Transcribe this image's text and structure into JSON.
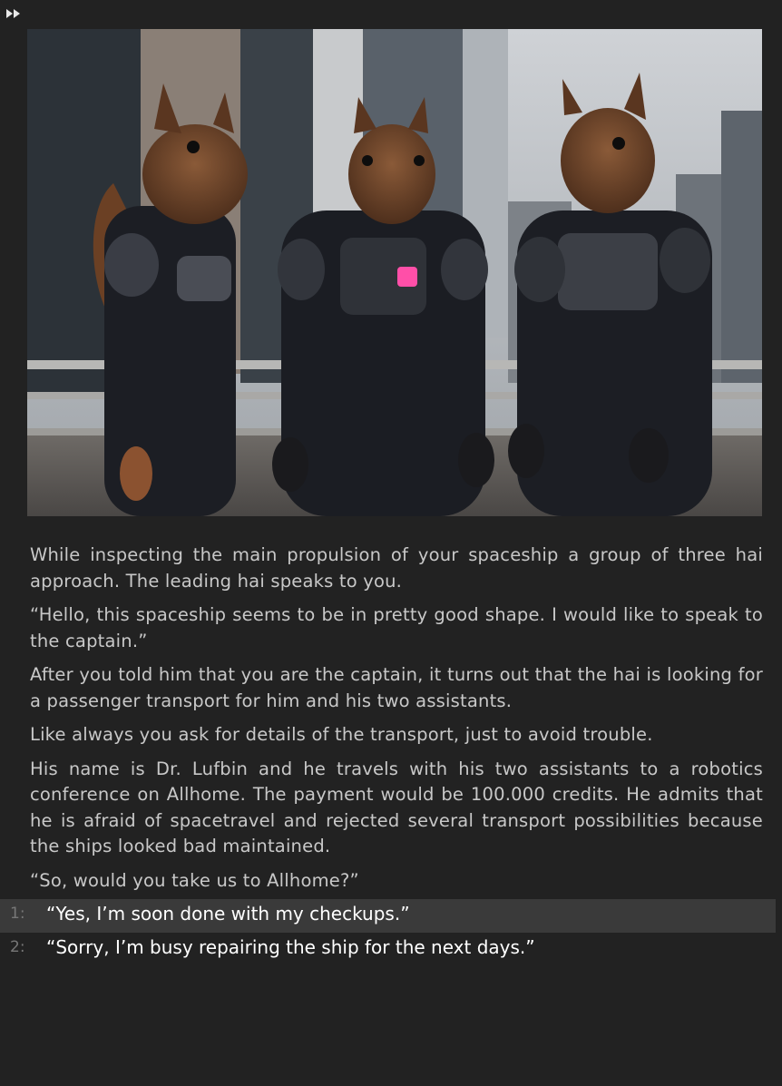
{
  "toolbar": {
    "skip_icon": "fast-forward-icon"
  },
  "scene": {
    "description_icon": "squirrel-crew-image"
  },
  "story": {
    "paragraphs": [
      "While inspecting the main propulsion of your spaceship a group of three hai approach. The leading hai speaks to you.",
      "“Hello, this spaceship seems to be in pretty good shape. I would like to speak to the captain.”",
      "After you told him that you are the captain, it turns out that the hai is looking for a passenger transport for him and his two assistants.",
      "Like always you ask for details of the transport, just to avoid trouble.",
      "His name is Dr. Lufbin and he travels with his two assistants to a robotics conference on Allhome. The payment would be 100.000 credits. He admits that he is afraid of spacetravel and rejected several transport possibilities because the ships looked bad maintained.",
      "“So, would you take us to Allhome?”"
    ]
  },
  "choices": [
    {
      "num": "1:",
      "text": "“Yes, I’m soon done with my checkups.”",
      "highlighted": true
    },
    {
      "num": "2:",
      "text": "“Sorry, I’m busy repairing the ship for the next days.”",
      "highlighted": false
    }
  ],
  "colors": {
    "background": "#222222",
    "text": "#c8c8c8",
    "choice_text": "#ffffff",
    "highlight": "#3a3a3a"
  }
}
